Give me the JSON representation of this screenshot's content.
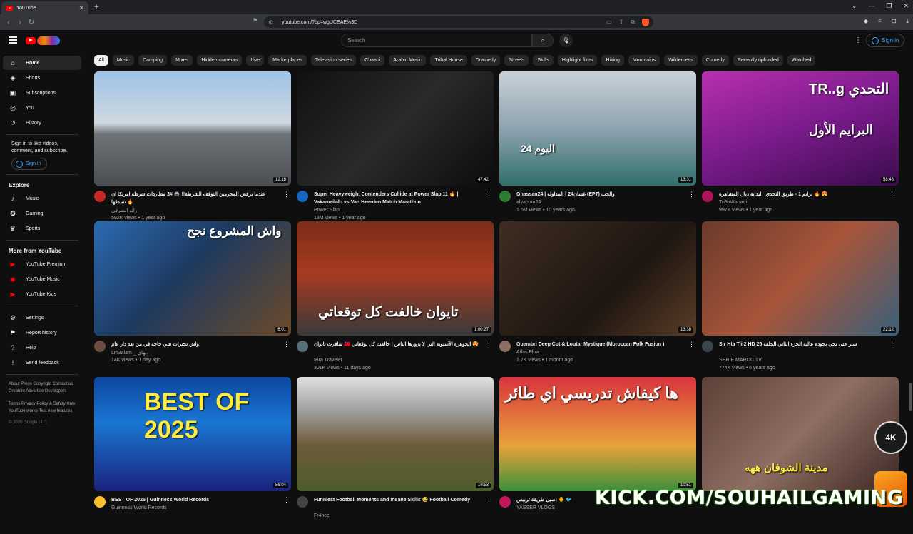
{
  "browser": {
    "tab_title": "YouTube",
    "url": "youtube.com/?bp=wgUCEAE%3D",
    "new_tab_label": "+"
  },
  "header": {
    "search_placeholder": "Search",
    "signin_label": "Sign in"
  },
  "sidebar": {
    "main": [
      {
        "label": "Home",
        "icon": "home-icon"
      },
      {
        "label": "Shorts",
        "icon": "shorts-icon"
      },
      {
        "label": "Subscriptions",
        "icon": "subscriptions-icon"
      },
      {
        "label": "You",
        "icon": "you-icon"
      },
      {
        "label": "History",
        "icon": "history-icon"
      }
    ],
    "signin_note": "Sign in to like videos, comment, and subscribe.",
    "signin_label": "Sign in",
    "explore_heading": "Explore",
    "explore": [
      {
        "label": "Music",
        "icon": "music-icon"
      },
      {
        "label": "Gaming",
        "icon": "gaming-icon"
      },
      {
        "label": "Sports",
        "icon": "sports-icon"
      }
    ],
    "more_heading": "More from YouTube",
    "more": [
      {
        "label": "YouTube Premium"
      },
      {
        "label": "YouTube Music"
      },
      {
        "label": "YouTube Kids"
      }
    ],
    "settings": [
      {
        "label": "Settings"
      },
      {
        "label": "Report history"
      },
      {
        "label": "Help"
      },
      {
        "label": "Send feedback"
      }
    ],
    "footer1": "About  Press  Copyright  Contact us  Creators  Advertise  Developers",
    "footer2": "Terms  Privacy  Policy & Safety  How YouTube works  Test new features",
    "copyright": "© 2026 Google LLC"
  },
  "chips": [
    "All",
    "Music",
    "Camping",
    "Mixes",
    "Hidden cameras",
    "Live",
    "Marketplaces",
    "Television series",
    "Chaabi",
    "Arabic Music",
    "Tribal House",
    "Dramedy",
    "Streets",
    "Skills",
    "Highlight films",
    "Hiking",
    "Mountains",
    "Wilderness",
    "Comedy",
    "Recently uploaded",
    "Watched"
  ],
  "videos": [
    {
      "title": "عندما يرفض المجرمين التوقف الشرطة!! 🚔 #3 مطاردات شرطة امريكا ان تصدقها 🔥",
      "channel": "رائد الشرقي",
      "stats": "592K views • 1 year ago",
      "duration": "12:18"
    },
    {
      "title": "Super Heavyweight Contenders Collide at Power Slap 11 🔥 | Vakameilalo vs Van Heerden Match Marathon",
      "channel": "Power Slap",
      "stats": "13M views • 1 year ago",
      "duration": "47:42"
    },
    {
      "title": "Ghassan24 | غسان24 | المداولة (EP7) والحب",
      "channel": "alyaoum24",
      "stats": "1.6M views • 10 years ago",
      "duration": "13:31"
    },
    {
      "title": "برايم 1 - طريق التحدي: البداية ديال المشاهرة 🔥 😍",
      "channel": "Tri9 Attahadi",
      "stats": "997K views • 1 year ago",
      "duration": "58:48"
    },
    {
      "title": "واش تجيرات شي حاجة في من بعد دار عام",
      "channel": "Lm3alam _ ديهاي",
      "stats": "14K views • 1 day ago",
      "duration": "6:01"
    },
    {
      "title": "سافرت تايوان 🇹🇼 الجوهرة الآسيوية التي لا يزورها الناس | خالفت كل توقعاتي 😍",
      "channel": "IBra Traveler",
      "stats": "301K views • 11 days ago",
      "duration": "1:00:27"
    },
    {
      "title": "Guembri Deep Cut & Loutar Mystique (Moroccan Folk Fusion )",
      "channel": "Atlas Flow",
      "stats": "1.7K views • 1 month ago",
      "duration": "13:38"
    },
    {
      "title": "Sir Hta Tji 2 HD 25 سير حتى تجي بجودة عالية الجزء الثاني الحلقة",
      "channel": "SERIE MAROC TV",
      "stats": "774K views • 6 years ago",
      "duration": "22:12"
    },
    {
      "title": "BEST OF 2025 | Guinness World Records",
      "channel": "Guinness World Records",
      "stats": "",
      "duration": "56:04"
    },
    {
      "title": "Funniest Football Moments and Insane Skills 😂 Football Comedy",
      "channel": "Fr4nce",
      "stats": "",
      "duration": "19:53"
    },
    {
      "title": "اصيل طريقة تربيس 🐥 🐦",
      "channel": "YASSER VLOGS",
      "stats": "",
      "duration": "10:51"
    },
    {
      "title": "",
      "channel": "",
      "stats": "",
      "duration": ""
    }
  ],
  "thumb_text": {
    "t1": "TR..g التحدي",
    "t1b": "البرايم الأول",
    "t2": "واش المشروع نجح",
    "t3": "تايوان خالفت كل توقعاتي",
    "t4": "BEST OF 2025",
    "t5": "ها كيفاش تدريسي اي طائر",
    "t6": "مدينة الشوفان ههه",
    "t7": "اليوم 24"
  },
  "overlays": {
    "kick": "KICK.COM/SOUHAILGAMING",
    "badge": "4K"
  }
}
